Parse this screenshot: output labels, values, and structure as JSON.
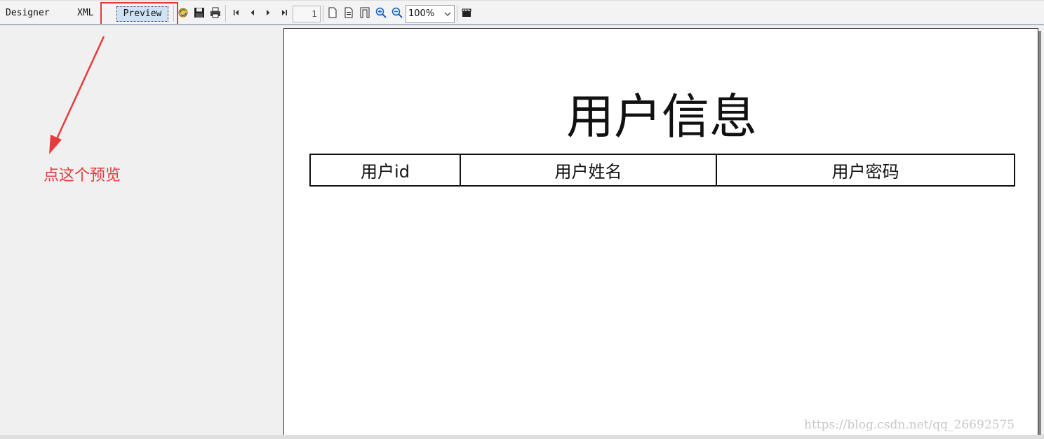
{
  "tabs": {
    "designer": "Designer",
    "xml": "XML",
    "preview": "Preview"
  },
  "toolbar": {
    "page_number": "1",
    "zoom": "100%",
    "icons": [
      "refresh-icon",
      "save-icon",
      "print-icon",
      "first-page-icon",
      "prev-page-icon",
      "next-page-icon",
      "last-page-icon",
      "page-icon",
      "page-width-icon",
      "whole-page-icon",
      "zoom-in-icon",
      "zoom-out-icon",
      "export-icon"
    ]
  },
  "annotation": {
    "text": "点这个预览",
    "color": "#e83a3a"
  },
  "report": {
    "title": "用户信息",
    "columns": [
      "用户id",
      "用户姓名",
      "用户密码"
    ]
  },
  "watermark": "https://blog.csdn.net/qq_26692575",
  "colors": {
    "highlight": "#e83a3a",
    "preview_tab_bg": "#cfe3f7"
  }
}
